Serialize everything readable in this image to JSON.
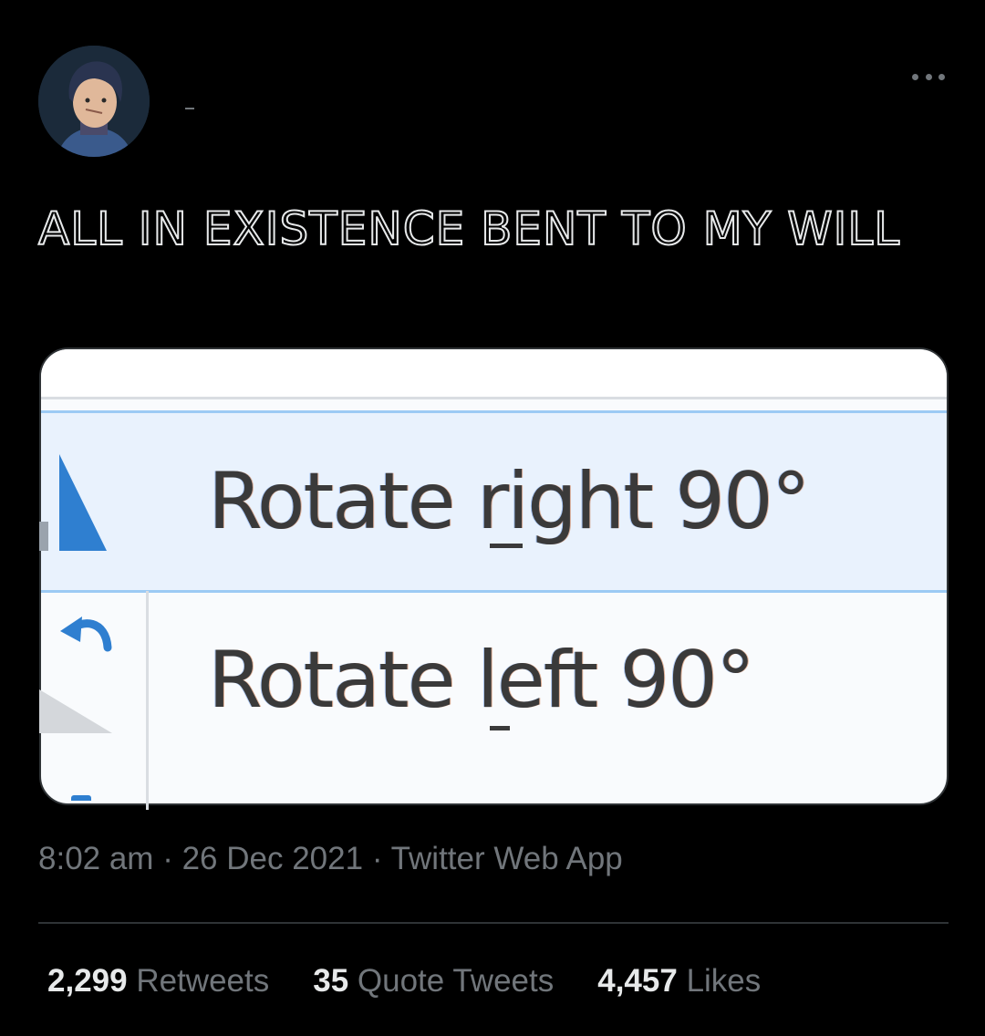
{
  "tweet": {
    "text": "ALL IN EXISTENCE BENT TO MY WILL",
    "timestamp": "8:02 am",
    "date": "26 Dec 2021",
    "source": "Twitter Web App",
    "separator": "·"
  },
  "image_menu": {
    "item_1": "Rotate right 90°",
    "item_2": "Rotate left 90°"
  },
  "stats": [
    {
      "count": "2,299",
      "label": "Retweets"
    },
    {
      "count": "35",
      "label": "Quote Tweets"
    },
    {
      "count": "4,457",
      "label": "Likes"
    }
  ],
  "icons": {
    "more": "more-horizontal-icon",
    "rotate_right": "rotate-right-triangle-icon",
    "rotate_left": "undo-arrow-icon"
  },
  "colors": {
    "background": "#000000",
    "text": "#e7e9ea",
    "secondary": "#71767b",
    "divider": "#2f3336",
    "menu_highlight": "#e9f2fd",
    "menu_accent": "#2f7fd0"
  }
}
